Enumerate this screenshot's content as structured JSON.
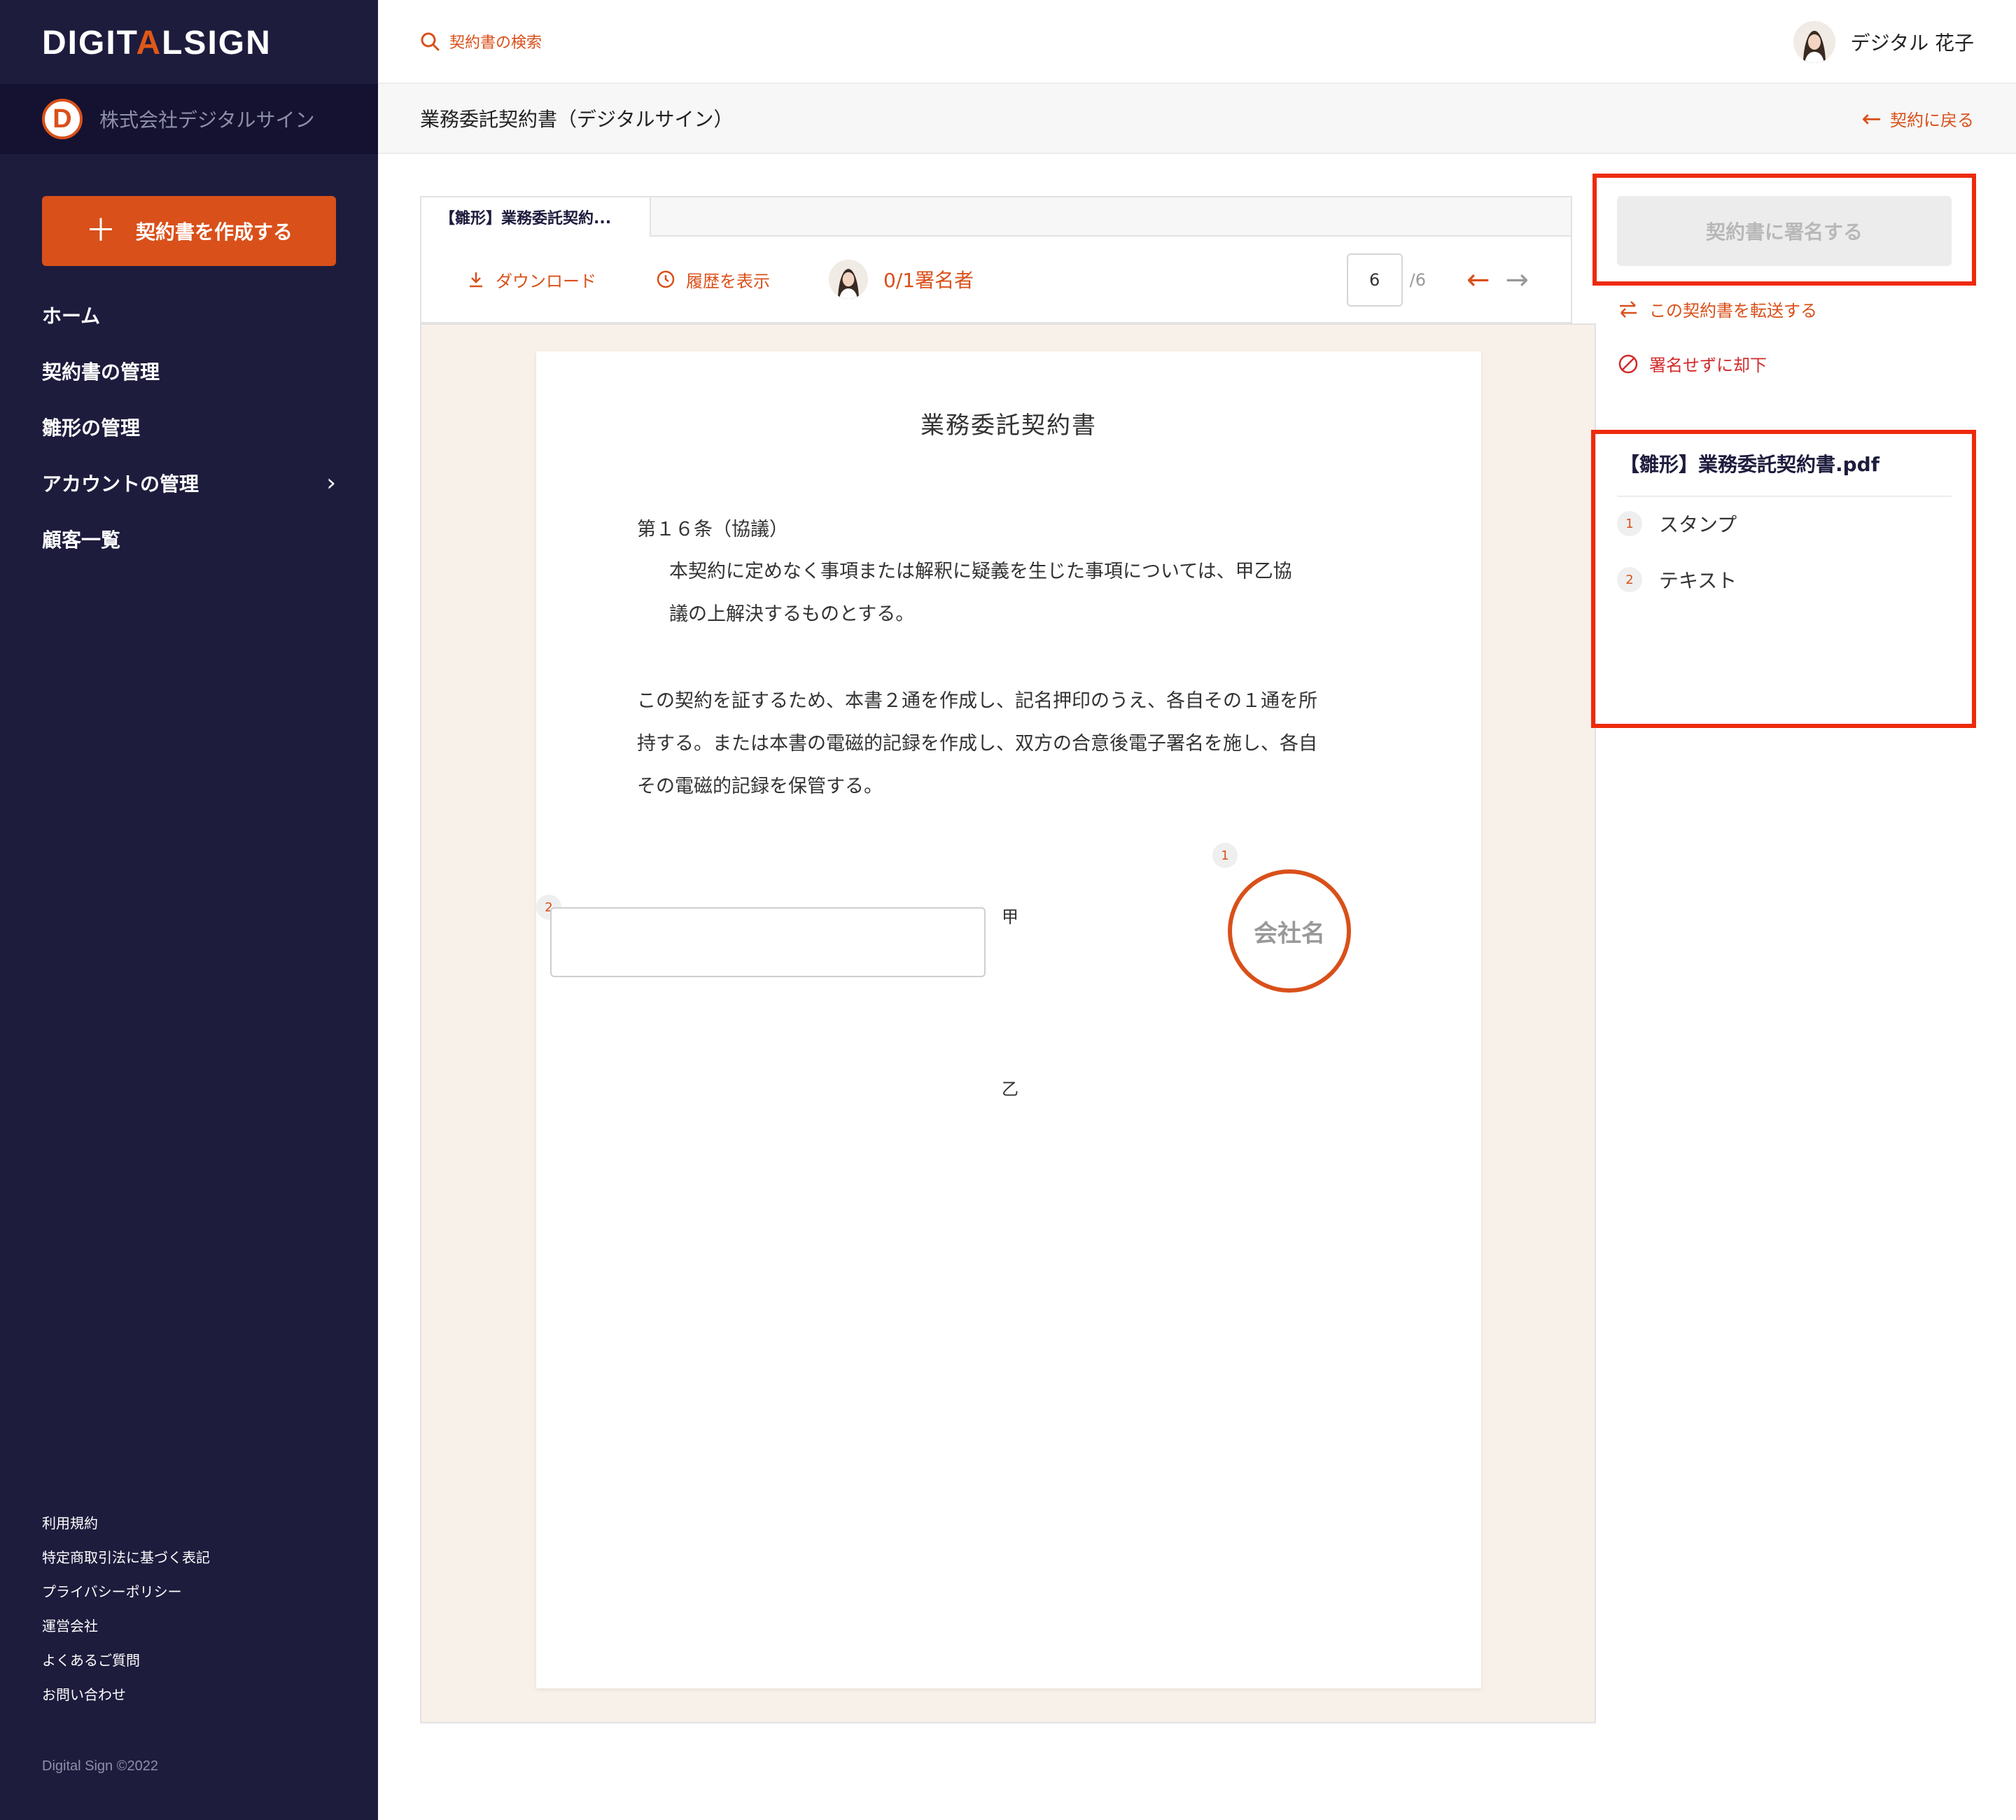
{
  "brand": {
    "logo_part1": "DIGIT",
    "logo_accent": "A",
    "logo_part2": "LSIGN",
    "org_initial": "D",
    "org_name": "株式会社デジタルサイン",
    "accent_color": "#d9501a",
    "sidebar_color": "#1e1c3d"
  },
  "sidebar": {
    "create_button": "契約書を作成する",
    "nav": [
      {
        "label": "ホーム"
      },
      {
        "label": "契約書の管理"
      },
      {
        "label": "雛形の管理"
      },
      {
        "label": "アカウントの管理",
        "has_submenu": true
      },
      {
        "label": "顧客一覧"
      }
    ],
    "footer_links": [
      "利用規約",
      "特定商取引法に基づく表記",
      "プライバシーポリシー",
      "運営会社",
      "よくあるご質問",
      "お問い合わせ"
    ],
    "copyright": "Digital Sign ©2022"
  },
  "header": {
    "search_label": "契約書の検索",
    "user_name": "デジタル 花子"
  },
  "titlebar": {
    "title": "業務委託契約書（デジタルサイン）",
    "back_label": "契約に戻る"
  },
  "viewer": {
    "tab_label": "【雛形】業務委託契約...",
    "download_label": "ダウンロード",
    "history_label": "履歴を表示",
    "signers_label": "0/1署名者",
    "current_page": "6",
    "total_pages": "/6"
  },
  "document": {
    "heading": "業務委託契約書",
    "article_title": "第１６条（協議）",
    "article_line1": "本契約に定めなく事項または解釈に疑義を生じた事項については、甲乙協",
    "article_line2": "議の上解決するものとする。",
    "closing_line1": "この契約を証するため、本書２通を作成し、記名押印のうえ、各自その１通を所",
    "closing_line2": "持する。または本書の電磁的記録を作成し、双方の合意後電子署名を施し、各自",
    "closing_line3": "その電磁的記録を保管する。",
    "party_a": "甲",
    "party_b": "乙",
    "stamp_badge": "1",
    "text_badge": "2",
    "stamp_label": "会社名"
  },
  "side_panel": {
    "sign_button": "契約書に署名する",
    "forward_label": "この契約書を転送する",
    "reject_label": "署名せずに却下",
    "file_name": "【雛形】業務委託契約書.pdf",
    "fields": [
      {
        "num": "1",
        "label": "スタンプ"
      },
      {
        "num": "2",
        "label": "テキスト"
      }
    ],
    "highlight_color": "#ee2a0c"
  }
}
